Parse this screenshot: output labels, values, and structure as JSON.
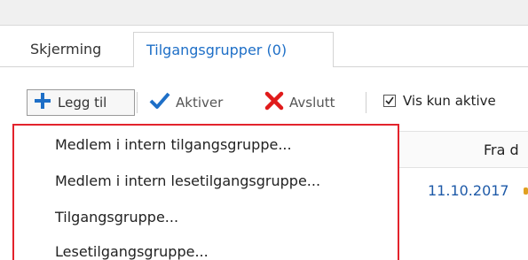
{
  "tabs": [
    {
      "label": "Skjerming"
    },
    {
      "label": "Tilgangsgrupper (0)"
    }
  ],
  "toolbar": {
    "add_label": "Legg til",
    "activate_label": "Aktiver",
    "end_label": "Avslutt",
    "show_active_label": "Vis kun aktive",
    "show_active_checked": true
  },
  "grid": {
    "column_header_partial": "Fra d",
    "row_date_partial": "11.10.2017"
  },
  "menu": {
    "items": [
      {
        "label": "Medlem i intern tilgangsgruppe..."
      },
      {
        "label": "Medlem i intern lesetilgangsgruppe..."
      },
      {
        "label": "Tilgangsgruppe..."
      },
      {
        "label": "Lesetilgangsgruppe..."
      }
    ]
  },
  "colors": {
    "accent_blue": "#1e6fc7",
    "highlight_red": "#e3232c",
    "close_red": "#e01b1b"
  },
  "icons": {
    "add": "plus-icon",
    "activate": "checkmark-icon",
    "end": "x-icon"
  }
}
